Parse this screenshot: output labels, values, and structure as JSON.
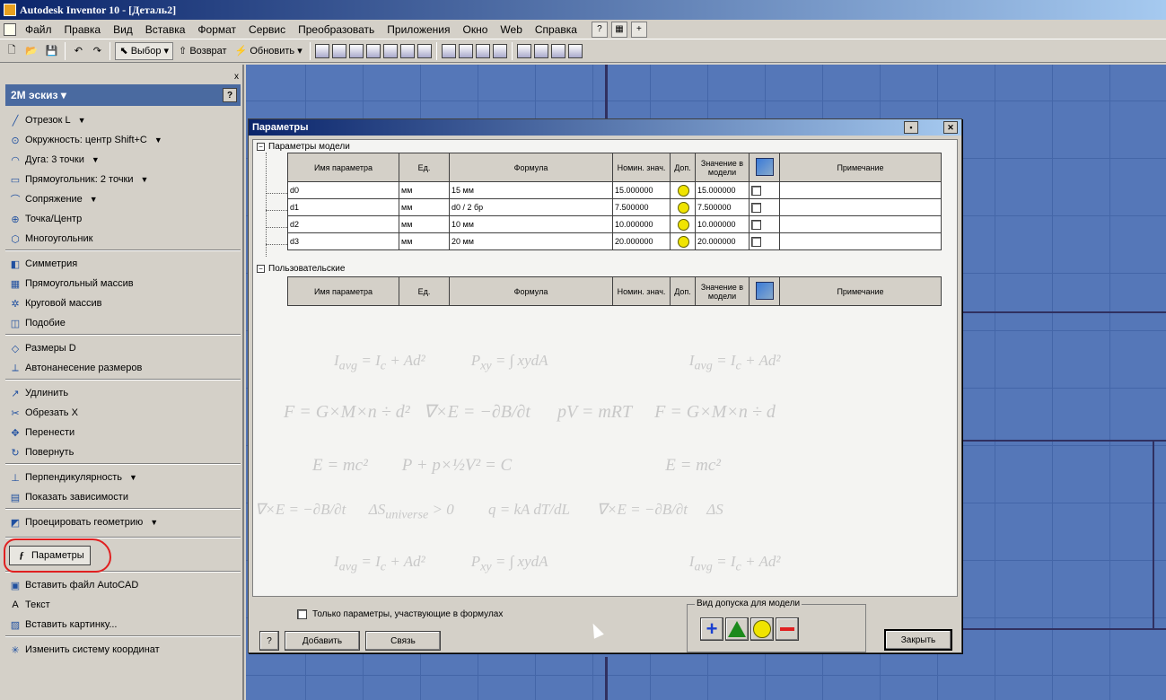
{
  "window": {
    "title": "Autodesk Inventor 10 - [Деталь2]"
  },
  "menu": {
    "items": [
      "Файл",
      "Правка",
      "Вид",
      "Вставка",
      "Формат",
      "Сервис",
      "Преобразовать",
      "Приложения",
      "Окно",
      "Web",
      "Справка"
    ]
  },
  "toolbar": {
    "select_label": "Выбор",
    "return_label": "Возврат",
    "update_label": "Обновить"
  },
  "panel": {
    "title": "2М эскиз",
    "help": "?",
    "close": "x",
    "commands": [
      {
        "label": "Отрезок  L",
        "icon": "line-icon",
        "dropdown": true
      },
      {
        "label": "Окружность: центр  Shift+C",
        "icon": "circle-icon",
        "dropdown": true
      },
      {
        "label": "Дуга: 3 точки",
        "icon": "arc-icon",
        "dropdown": true
      },
      {
        "label": "Прямоугольник: 2 точки",
        "icon": "rectangle-icon",
        "dropdown": true
      },
      {
        "label": "Сопряжение",
        "icon": "fillet-icon",
        "dropdown": true
      },
      {
        "label": "Точка/Центр",
        "icon": "point-icon",
        "dropdown": false
      },
      {
        "label": "Многоугольник",
        "icon": "polygon-icon",
        "dropdown": false
      },
      {
        "label": "Симметрия",
        "icon": "mirror-icon",
        "dropdown": false
      },
      {
        "label": "Прямоугольный массив",
        "icon": "rect-array-icon",
        "dropdown": false
      },
      {
        "label": "Круговой массив",
        "icon": "circ-array-icon",
        "dropdown": false
      },
      {
        "label": "Подобие",
        "icon": "offset-icon",
        "dropdown": false
      },
      {
        "label": "Размеры  D",
        "icon": "dimension-icon",
        "dropdown": false
      },
      {
        "label": "Автонанесение размеров",
        "icon": "auto-dimension-icon",
        "dropdown": false
      },
      {
        "label": "Удлинить",
        "icon": "extend-icon",
        "dropdown": false
      },
      {
        "label": "Обрезать  X",
        "icon": "trim-icon",
        "dropdown": false
      },
      {
        "label": "Перенести",
        "icon": "move-icon",
        "dropdown": false
      },
      {
        "label": "Повернуть",
        "icon": "rotate-icon",
        "dropdown": false
      },
      {
        "label": "Перпендикулярность",
        "icon": "perpendicular-icon",
        "dropdown": true
      },
      {
        "label": "Показать зависимости",
        "icon": "show-constraints-icon",
        "dropdown": false
      },
      {
        "label": "Проецировать геометрию",
        "icon": "project-geometry-icon",
        "dropdown": true
      },
      {
        "label": "Параметры",
        "icon": "fx-icon",
        "dropdown": false
      },
      {
        "label": "Вставить файл AutoCAD",
        "icon": "autocad-icon",
        "dropdown": false
      },
      {
        "label": "Текст",
        "icon": "text-icon",
        "dropdown": false
      },
      {
        "label": "Вставить картинку...",
        "icon": "image-icon",
        "dropdown": false
      },
      {
        "label": "Изменить систему координат",
        "icon": "coord-icon",
        "dropdown": false
      }
    ]
  },
  "dialog": {
    "title": "Параметры",
    "model_group": "Параметры модели",
    "user_group": "Пользовательские",
    "columns": [
      "Имя параметра",
      "Ед.",
      "Формула",
      "Номин. знач.",
      "Доп.",
      "Значение в модели",
      "",
      "Примечание"
    ],
    "rows": [
      {
        "name": "d0",
        "unit": "мм",
        "formula": "15 мм",
        "nominal": "15.000000",
        "model": "15.000000"
      },
      {
        "name": "d1",
        "unit": "мм",
        "formula": "d0 / 2 бр",
        "nominal": "7.500000",
        "model": "7.500000"
      },
      {
        "name": "d2",
        "unit": "мм",
        "formula": "10 мм",
        "nominal": "10.000000",
        "model": "10.000000"
      },
      {
        "name": "d3",
        "unit": "мм",
        "formula": "20 мм",
        "nominal": "20.000000",
        "model": "20.000000"
      }
    ],
    "checkbox_label": "Только параметры, участвующие в формулах",
    "help": "?",
    "add_label": "Добавить",
    "link_label": "Связь",
    "tolerance_group": "Вид допуска для модели",
    "close_label": "Закрыть"
  },
  "colors": {
    "canvas": "#5577b8",
    "tolerance_yellow": "#f0e400",
    "tol_plus": "#1a40d0",
    "tol_triangle": "#1c8a1c",
    "tol_minus": "#e02020"
  }
}
